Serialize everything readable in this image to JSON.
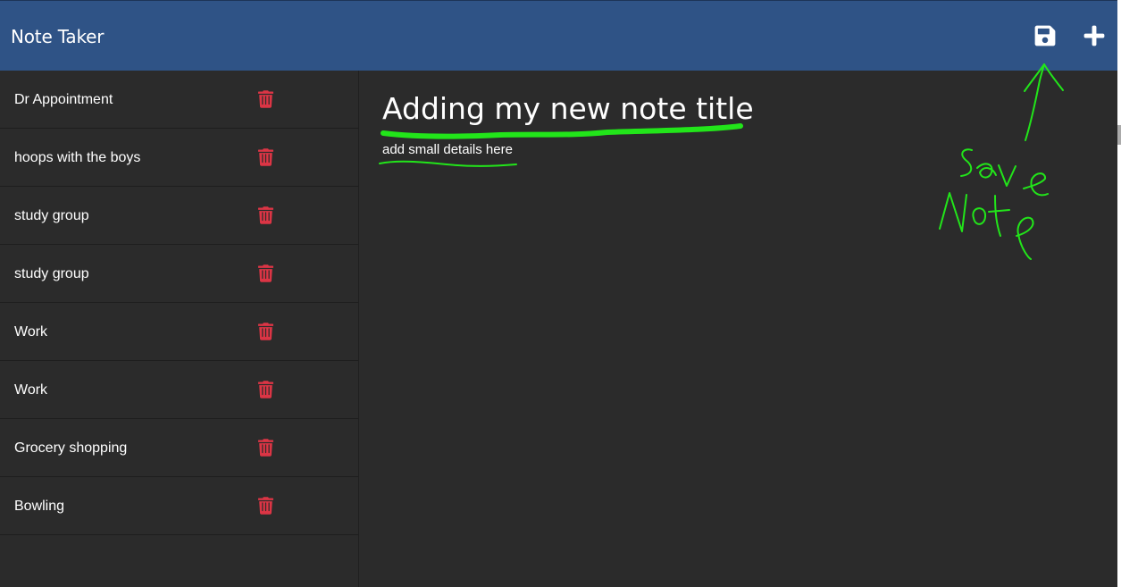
{
  "app": {
    "title": "Note Taker"
  },
  "navbar": {
    "save_icon": "floppy-disk-icon",
    "new_icon": "plus-icon",
    "background": "#2f5386"
  },
  "notes": [
    {
      "title": "Dr Appointment"
    },
    {
      "title": "hoops with the boys"
    },
    {
      "title": "study group"
    },
    {
      "title": "study group"
    },
    {
      "title": "Work"
    },
    {
      "title": "Work"
    },
    {
      "title": "Grocery shopping"
    },
    {
      "title": "Bowling"
    }
  ],
  "delete_icon": "trash-icon",
  "editor": {
    "title_value": "Adding my new note title",
    "body_value": "add small details here"
  },
  "annotation": {
    "text": "Save Note",
    "color": "#22e51a"
  },
  "colors": {
    "background": "#2b2b2b",
    "trash": "#dc3545"
  }
}
